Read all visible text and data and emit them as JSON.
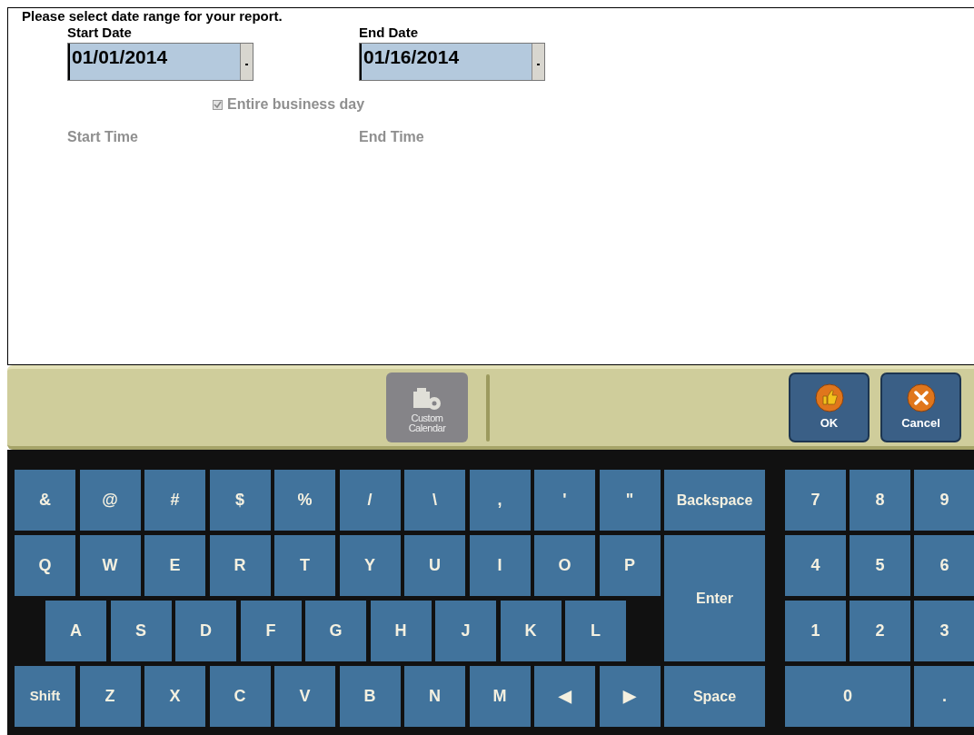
{
  "form": {
    "prompt": "Please select date range for your report.",
    "start_date": {
      "label": "Start Date",
      "value": "01/01/2014"
    },
    "end_date": {
      "label": "End Date",
      "value": "01/16/2014"
    },
    "entire_business_day": {
      "label": "Entire business day",
      "checked": true,
      "disabled": true
    },
    "start_time": {
      "label": "Start Time",
      "disabled": true
    },
    "end_time": {
      "label": "End Time",
      "disabled": true
    }
  },
  "toolbar": {
    "custom_calendar": {
      "label_lines": [
        "Custom",
        "Calendar"
      ],
      "disabled": true
    },
    "buttons": [
      {
        "label": "OK",
        "kind": "ok"
      },
      {
        "label": "Cancel",
        "kind": "cancel"
      }
    ]
  },
  "keyboard": {
    "rows": [
      [
        "&",
        "@",
        "#",
        "$",
        "%",
        "/",
        "\\",
        ",",
        "'",
        "\""
      ],
      [
        "Q",
        "W",
        "E",
        "R",
        "T",
        "Y",
        "U",
        "I",
        "O",
        "P"
      ],
      [
        "A",
        "S",
        "D",
        "F",
        "G",
        "H",
        "J",
        "K",
        "L"
      ],
      [
        "Shift",
        "Z",
        "X",
        "C",
        "V",
        "B",
        "N",
        "M",
        "◀",
        "▶"
      ]
    ],
    "side_keys": [
      "Backspace",
      "Enter",
      "Space"
    ],
    "numpad": [
      {
        "label": "7",
        "kind": "key"
      },
      {
        "label": "8",
        "kind": "key"
      },
      {
        "label": "9",
        "kind": "key"
      },
      {
        "label": "4",
        "kind": "key"
      },
      {
        "label": "5",
        "kind": "key"
      },
      {
        "label": "6",
        "kind": "key"
      },
      {
        "label": "1",
        "kind": "key"
      },
      {
        "label": "2",
        "kind": "key"
      },
      {
        "label": "3",
        "kind": "key"
      },
      {
        "label": "0",
        "kind": "wide"
      },
      {
        "label": ".",
        "kind": "key"
      }
    ]
  }
}
